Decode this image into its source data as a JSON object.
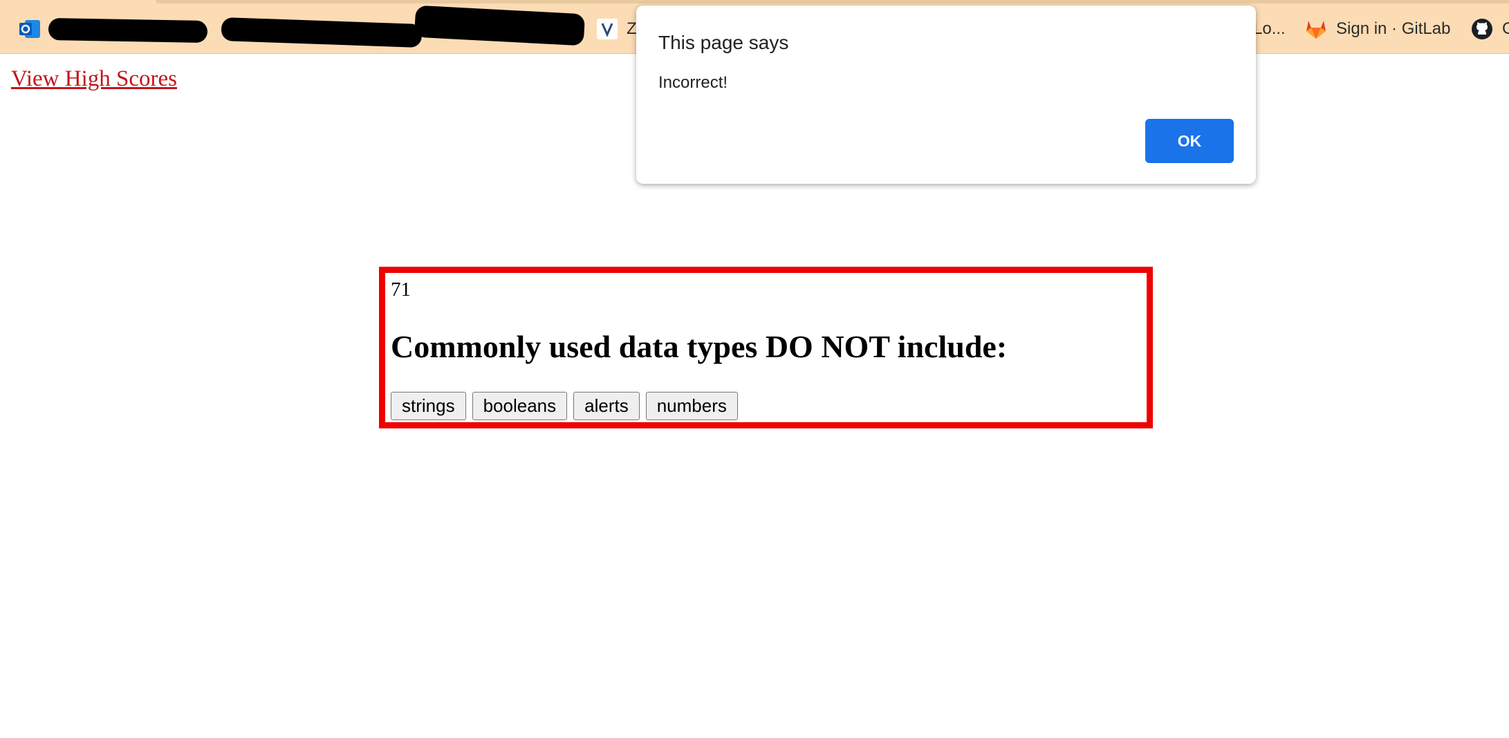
{
  "bookmarks_bar": {
    "items": [
      {
        "label": "Z",
        "icon": "vercel-v-icon"
      },
      {
        "label": "Lo...",
        "icon": ""
      },
      {
        "label": "Sign in · GitLab",
        "icon": "gitlab-icon"
      },
      {
        "label": "G",
        "icon": "github-icon"
      }
    ]
  },
  "page": {
    "high_scores_link": "View High Scores",
    "timer": "71",
    "question": "Commonly used data types DO NOT include:",
    "answers": [
      "strings",
      "booleans",
      "alerts",
      "numbers"
    ]
  },
  "dialog": {
    "title": "This page says",
    "message": "Incorrect!",
    "ok_label": "OK"
  },
  "colors": {
    "bookmarks_bg": "#fcdcb4",
    "link": "#c0161b",
    "quiz_border": "#ee0000",
    "ok_button": "#1a73e8"
  }
}
